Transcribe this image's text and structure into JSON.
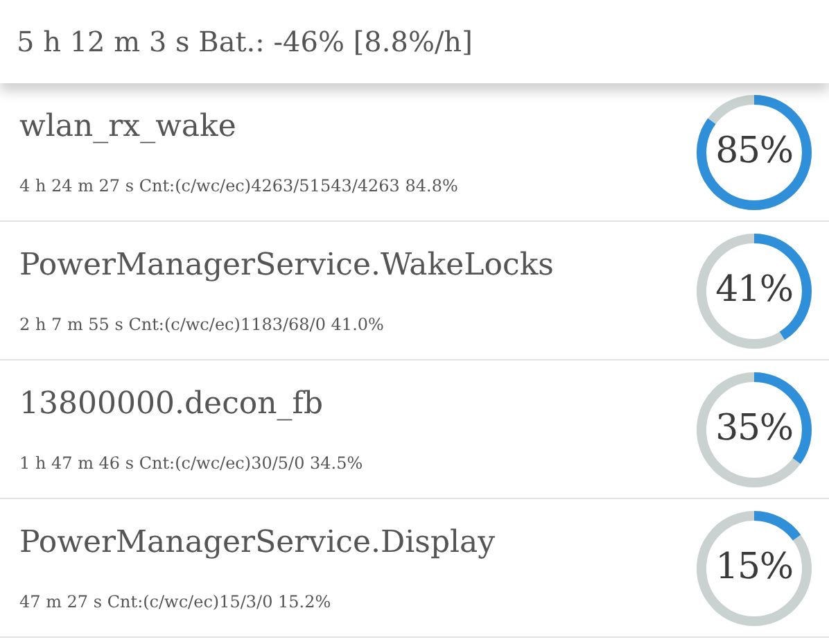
{
  "summary": "5 h 12 m 3 s Bat.: -46% [8.8%/h]",
  "items": [
    {
      "name": "wlan_rx_wake",
      "details": "4 h 24 m 27 s Cnt:(c/wc/ec)4263/51543/4263 84.8%",
      "percent": "85%",
      "level": 0.85
    },
    {
      "name": "PowerManagerService.WakeLocks",
      "details": "2 h 7 m 55 s Cnt:(c/wc/ec)1183/68/0 41.0%",
      "percent": "41%",
      "level": 0.41
    },
    {
      "name": "13800000.decon_fb",
      "details": "1 h 47 m 46 s Cnt:(c/wc/ec)30/5/0 34.5%",
      "percent": "35%",
      "level": 0.35
    },
    {
      "name": "PowerManagerService.Display",
      "details": "47 m 27 s Cnt:(c/wc/ec)15/3/0 15.2%",
      "percent": "15%",
      "level": 0.15
    }
  ]
}
